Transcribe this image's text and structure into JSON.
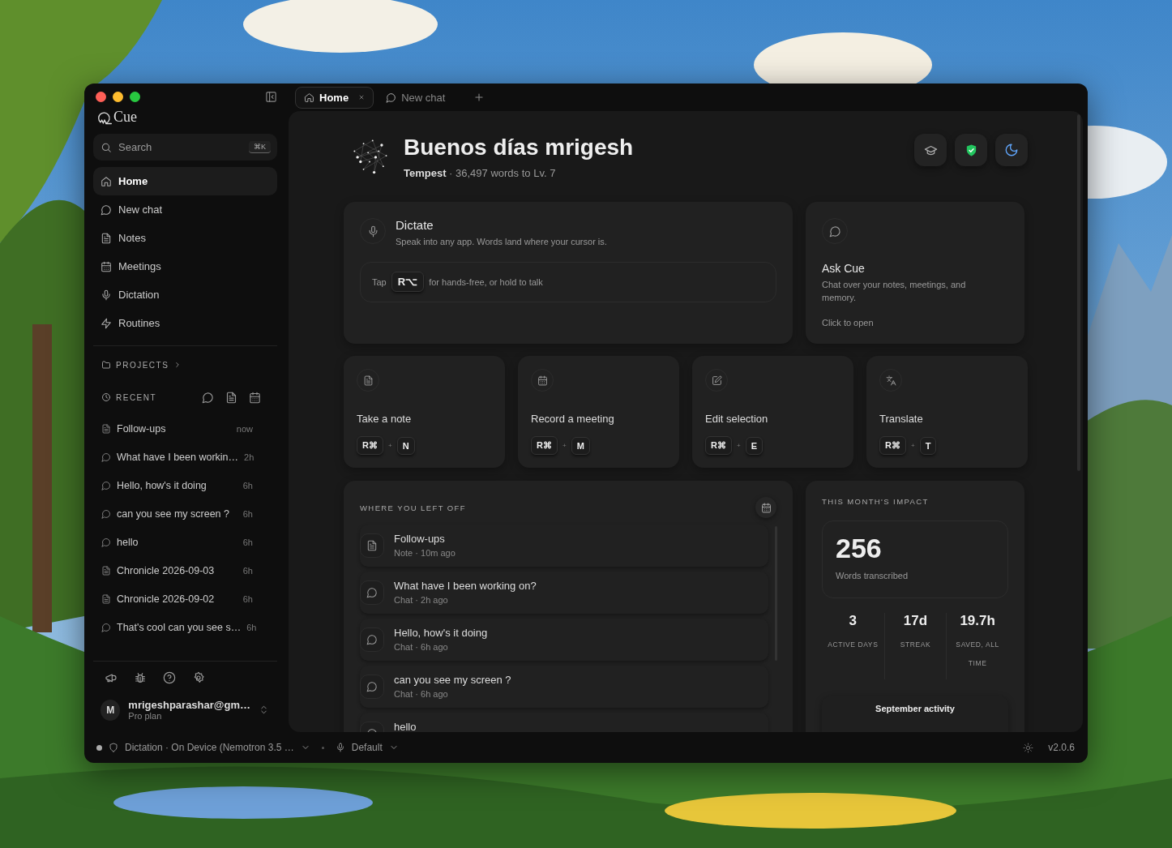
{
  "tabs": [
    {
      "label": "Home",
      "kind": "home",
      "selected": true
    },
    {
      "label": "New chat",
      "kind": "chat",
      "selected": false
    }
  ],
  "sidebar": {
    "app_name": "Cue",
    "search": {
      "placeholder": "Search",
      "shortcut": "⌘K"
    },
    "nav": [
      {
        "label": "Home",
        "kind": "home",
        "selected": true
      },
      {
        "label": "New chat",
        "kind": "chat",
        "selected": false
      },
      {
        "label": "Notes",
        "kind": "note",
        "selected": false
      },
      {
        "label": "Meetings",
        "kind": "calendar",
        "selected": false
      },
      {
        "label": "Dictation",
        "kind": "mic",
        "selected": false
      },
      {
        "label": "Routines",
        "kind": "zap",
        "selected": false
      }
    ],
    "projects_label": "PROJECTS",
    "recent_label": "RECENT",
    "recent": [
      {
        "kind": "note",
        "title": "Follow-ups",
        "time": "now"
      },
      {
        "kind": "chat",
        "title": "What have I been workin…",
        "time": "2h"
      },
      {
        "kind": "chat",
        "title": "Hello, how's it doing",
        "time": "6h"
      },
      {
        "kind": "chat",
        "title": "can you see my screen ?",
        "time": "6h"
      },
      {
        "kind": "chat",
        "title": "hello",
        "time": "6h"
      },
      {
        "kind": "note",
        "title": "Chronicle 2026-09-03",
        "time": "6h"
      },
      {
        "kind": "note",
        "title": "Chronicle 2026-09-02",
        "time": "6h"
      },
      {
        "kind": "chat",
        "title": "That's cool can you see s…",
        "time": "6h"
      }
    ],
    "user": {
      "initial": "M",
      "name": "mrigeshparashar@gm…",
      "plan": "Pro plan"
    }
  },
  "greeting": {
    "title": "Buenos días mrigesh",
    "subtitle": "**Tempest** · 36,497 words to Lv. 7"
  },
  "dictate": {
    "title": "Dictate",
    "description": "Speak into any app. Words land where your cursor is.",
    "hint_prefix": "Tap",
    "key": "R⌥",
    "hint_suffix": "for hands-free, or hold to talk"
  },
  "ask": {
    "title": "Ask Cue",
    "description": "Chat over your notes, meetings, and memory.",
    "action": "Click to open"
  },
  "actions": [
    {
      "kind": "note",
      "title": "Take a note",
      "keys": [
        "R⌘",
        "N"
      ],
      "joiner": "+"
    },
    {
      "kind": "calendar",
      "title": "Record a meeting",
      "keys": [
        "R⌘",
        "M"
      ],
      "joiner": "+"
    },
    {
      "kind": "edit",
      "title": "Edit selection",
      "keys": [
        "R⌘",
        "E"
      ],
      "joiner": "+"
    },
    {
      "kind": "translate",
      "title": "Translate",
      "keys": [
        "R⌘",
        "T"
      ],
      "joiner": "+"
    }
  ],
  "left_off": {
    "title": "WHERE YOU LEFT OFF",
    "items": [
      {
        "kind": "note",
        "title": "Follow-ups",
        "meta": "Note · 10m ago"
      },
      {
        "kind": "chat",
        "title": "What have I been working on?",
        "meta": "Chat · 2h ago"
      },
      {
        "kind": "chat",
        "title": "Hello, how's it doing",
        "meta": "Chat · 6h ago"
      },
      {
        "kind": "chat",
        "title": "can you see my screen ?",
        "meta": "Chat · 6h ago"
      },
      {
        "kind": "chat",
        "title": "hello"
      }
    ]
  },
  "impact": {
    "title": "THIS MONTH'S IMPACT",
    "total": "256",
    "total_label": "Words transcribed",
    "stats": [
      {
        "value": "3",
        "label": "ACTIVE DAYS"
      },
      {
        "value": "17d",
        "label": "STREAK"
      },
      {
        "value": "19.7h",
        "label": "SAVED, ALL TIME"
      }
    ],
    "activity_title": "September activity"
  },
  "status_bar": {
    "dictation": "Dictation · On Device (Nemotron 3.5 …",
    "microphone": "Default",
    "version": "v2.0.6"
  }
}
